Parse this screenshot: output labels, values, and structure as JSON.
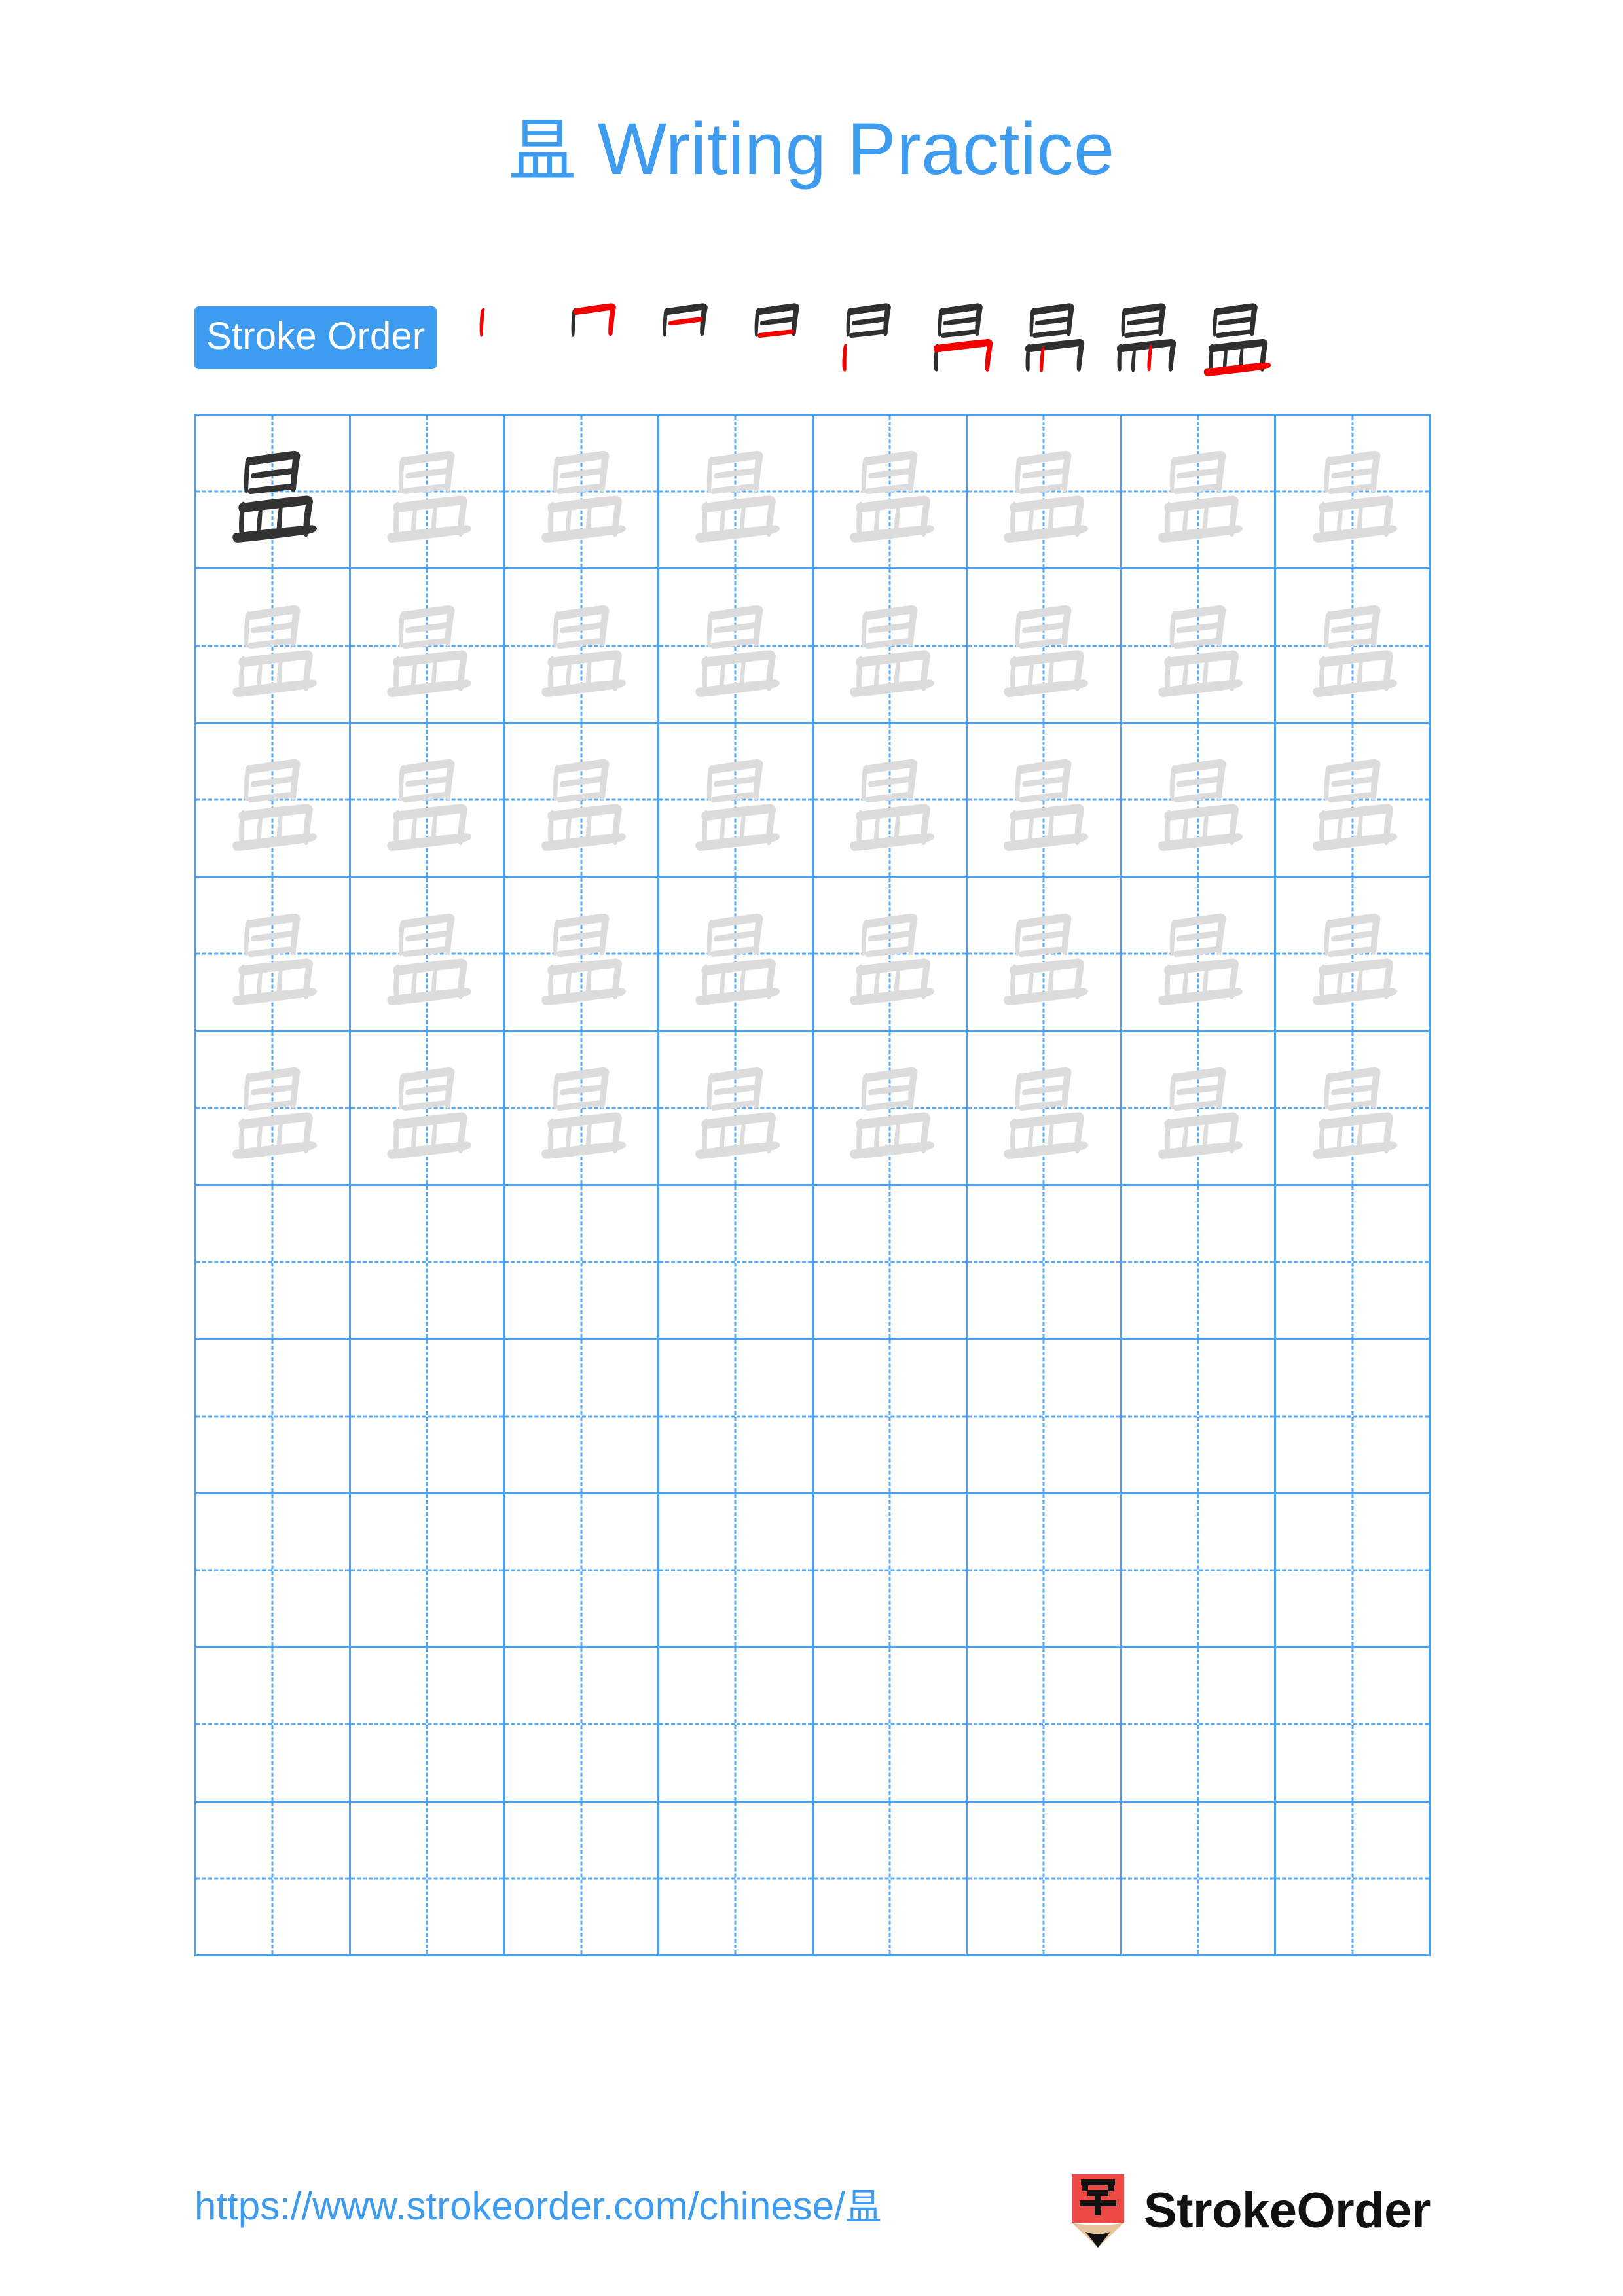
{
  "page": {
    "character": "昷",
    "background_color": "#ffffff",
    "accent_color": "#3D9BF0",
    "grid_line_color": "#4AA0F2",
    "model_glyph_color": "#333333",
    "trace_glyph_color": "#DCDCDC",
    "new_stroke_color": "#F40000",
    "done_stroke_color": "#2F2F2F"
  },
  "title": {
    "hanzi": "昷",
    "text": " Writing Practice",
    "full": "昷 Writing Practice"
  },
  "stroke_order": {
    "badge_label": "Stroke Order",
    "total_strokes": 9,
    "steps": [
      {
        "index": 1,
        "new_stroke": "vertical-left of 日"
      },
      {
        "index": 2,
        "new_stroke": "horizontal-top + vertical-right hook of 日"
      },
      {
        "index": 3,
        "new_stroke": "inner horizontal of 日"
      },
      {
        "index": 4,
        "new_stroke": "bottom horizontal closing 日"
      },
      {
        "index": 5,
        "new_stroke": "left vertical of 皿"
      },
      {
        "index": 6,
        "new_stroke": "top horizontal + right vertical of 皿"
      },
      {
        "index": 7,
        "new_stroke": "first inner vertical of 皿"
      },
      {
        "index": 8,
        "new_stroke": "second inner vertical of 皿"
      },
      {
        "index": 9,
        "new_stroke": "bottom long horizontal of 皿"
      }
    ]
  },
  "practice_grid": {
    "columns": 8,
    "rows": 10,
    "model_cell": {
      "row": 1,
      "column": 1
    },
    "filled_rows": 5,
    "empty_rows": 5,
    "row_fill": [
      "traced",
      "traced",
      "traced",
      "traced",
      "traced",
      "empty",
      "empty",
      "empty",
      "empty",
      "empty"
    ]
  },
  "footer": {
    "url_prefix": "https://www.strokeorder.com/chinese/",
    "url_hanzi": "昷",
    "url_full": "https://www.strokeorder.com/chinese/昷",
    "brand_name": "StrokeOrder",
    "logo_icon": "pencil-zi-icon",
    "logo_body_color": "#F04A46",
    "logo_wood_color": "#E5C49B",
    "logo_tip_color": "#111111",
    "logo_character": "字"
  }
}
